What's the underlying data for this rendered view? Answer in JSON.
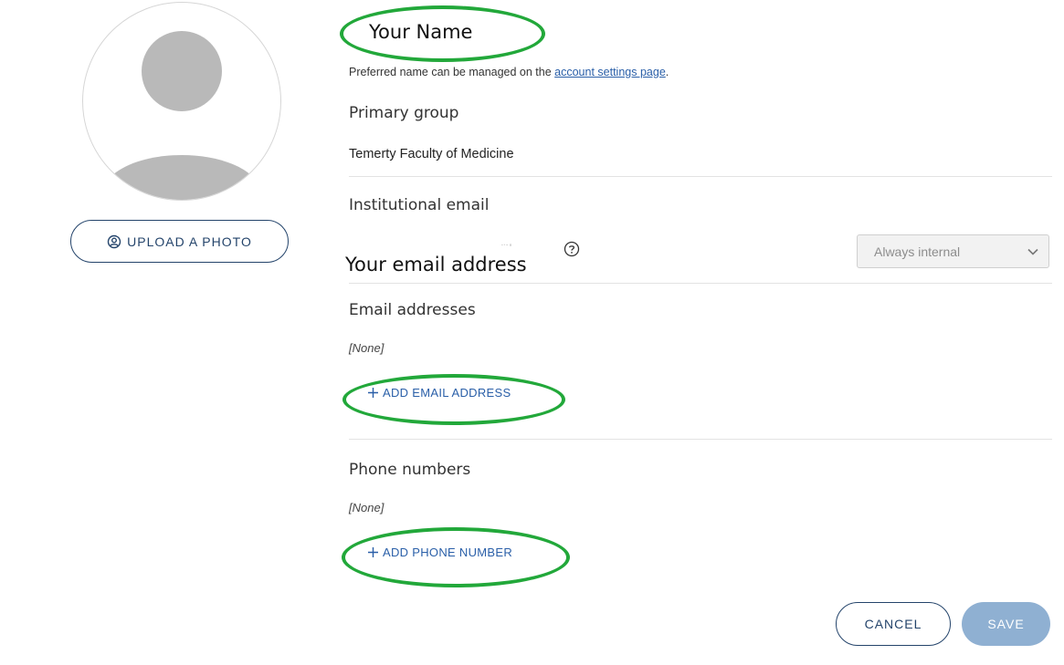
{
  "profile": {
    "upload_photo_label": "UPLOAD A PHOTO",
    "avatar_icon": "user-placeholder-icon"
  },
  "name": {
    "display_name": "Your Name",
    "preferred_note_prefix": "Preferred name can be managed on the ",
    "preferred_note_link": "account settings page",
    "preferred_note_suffix": "."
  },
  "primary_group": {
    "label": "Primary group",
    "value": "Temerty Faculty of Medicine"
  },
  "institutional_email": {
    "label": "Institutional email",
    "value": "Your email address",
    "help_icon": "question-circle-icon",
    "visibility_selected": "Always internal"
  },
  "email_addresses": {
    "label": "Email addresses",
    "empty_text": "[None]",
    "add_label": "ADD EMAIL ADDRESS"
  },
  "phone_numbers": {
    "label": "Phone numbers",
    "empty_text": "[None]",
    "add_label": "ADD PHONE NUMBER"
  },
  "actions": {
    "cancel_label": "CANCEL",
    "save_label": "SAVE"
  },
  "colors": {
    "accent": "#24446b",
    "link": "#2a5fa8",
    "annotation_green": "#22a83a",
    "save_disabled": "#8fb0d2"
  }
}
